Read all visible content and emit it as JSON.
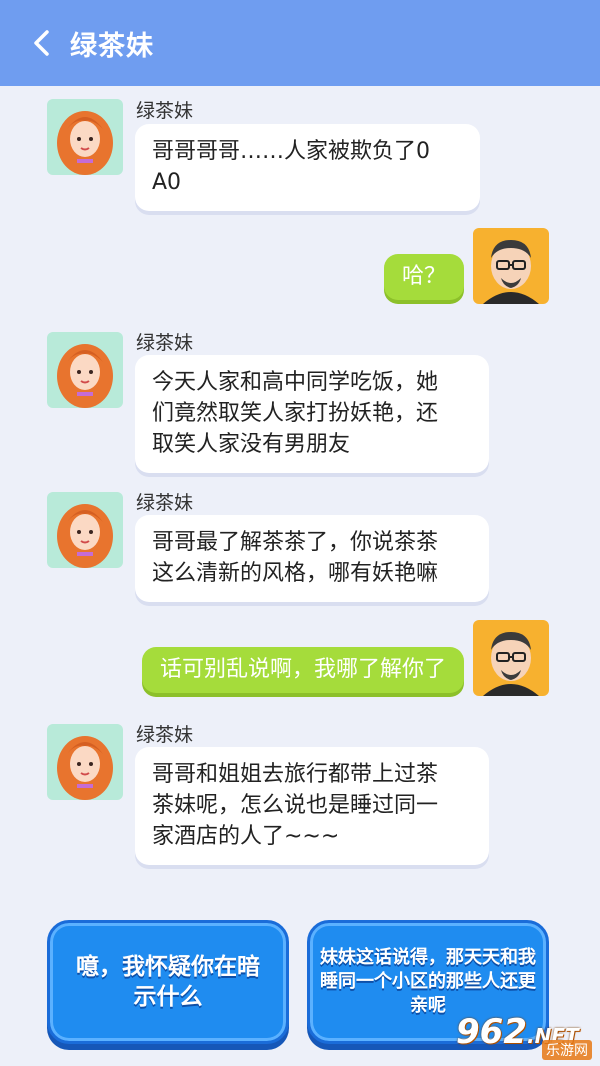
{
  "header": {
    "title": "绿茶妹"
  },
  "messages": [
    {
      "from": "contact",
      "sender": "绿茶妹",
      "lines": [
        "哥哥哥哥……人家被欺负了0",
        "A0"
      ]
    },
    {
      "from": "me",
      "text": "哈？"
    },
    {
      "from": "contact",
      "sender": "绿茶妹",
      "lines": [
        "今天人家和高中同学吃饭，她",
        "们竟然取笑人家打扮妖艳，还",
        "取笑人家没有男朋友"
      ]
    },
    {
      "from": "contact",
      "sender": "绿茶妹",
      "lines": [
        "哥哥最了解茶茶了，你说茶茶",
        "这么清新的风格，哪有妖艳嘛"
      ]
    },
    {
      "from": "me",
      "text": "话可别乱说啊，我哪了解你了"
    },
    {
      "from": "contact",
      "sender": "绿茶妹",
      "lines": [
        "哥哥和姐姐去旅行都带上过茶",
        "茶妹呢，怎么说也是睡过同一",
        "家酒店的人了~~~"
      ]
    }
  ],
  "choices": [
    {
      "lines": [
        "噫，我怀疑你在暗",
        "示什么"
      ]
    },
    {
      "lines": [
        "妹妹这话说得，那天天和我",
        "睡同一个小区的那些人还更",
        "亲呢"
      ]
    }
  ],
  "watermark": {
    "main": "962",
    "net": ".NET",
    "sub": "乐游网"
  },
  "colors": {
    "header": "#6f9df0",
    "background": "#edf0f9",
    "my_bubble": "#a5dc3b",
    "choice_button": "#1f8cf0"
  }
}
